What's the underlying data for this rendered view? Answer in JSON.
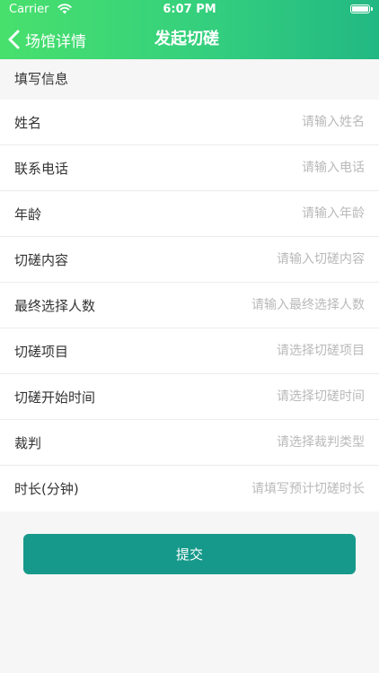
{
  "status_bar": {
    "carrier": "Carrier",
    "time": "6:07 PM"
  },
  "nav": {
    "back_label": "场馆详情",
    "title": "发起切磋"
  },
  "section_title": "填写信息",
  "form": {
    "fields": [
      {
        "label": "姓名",
        "placeholder": "请输入姓名"
      },
      {
        "label": "联系电话",
        "placeholder": "请输入电话"
      },
      {
        "label": "年龄",
        "placeholder": "请输入年龄"
      },
      {
        "label": "切磋内容",
        "placeholder": "请输入切磋内容"
      },
      {
        "label": "最终选择人数",
        "placeholder": "请输入最终选择人数"
      },
      {
        "label": "切磋项目",
        "placeholder": "请选择切磋项目"
      },
      {
        "label": "切磋开始时间",
        "placeholder": "请选择切磋时间"
      },
      {
        "label": "裁判",
        "placeholder": "请选择裁判类型"
      },
      {
        "label": "时长(分钟)",
        "placeholder": "请填写预计切磋时长"
      }
    ]
  },
  "submit_label": "提交",
  "colors": {
    "header_gradient_start": "#48e06c",
    "header_gradient_end": "#22b883",
    "submit_button": "#16998a",
    "page_background": "#f6f6f6"
  }
}
